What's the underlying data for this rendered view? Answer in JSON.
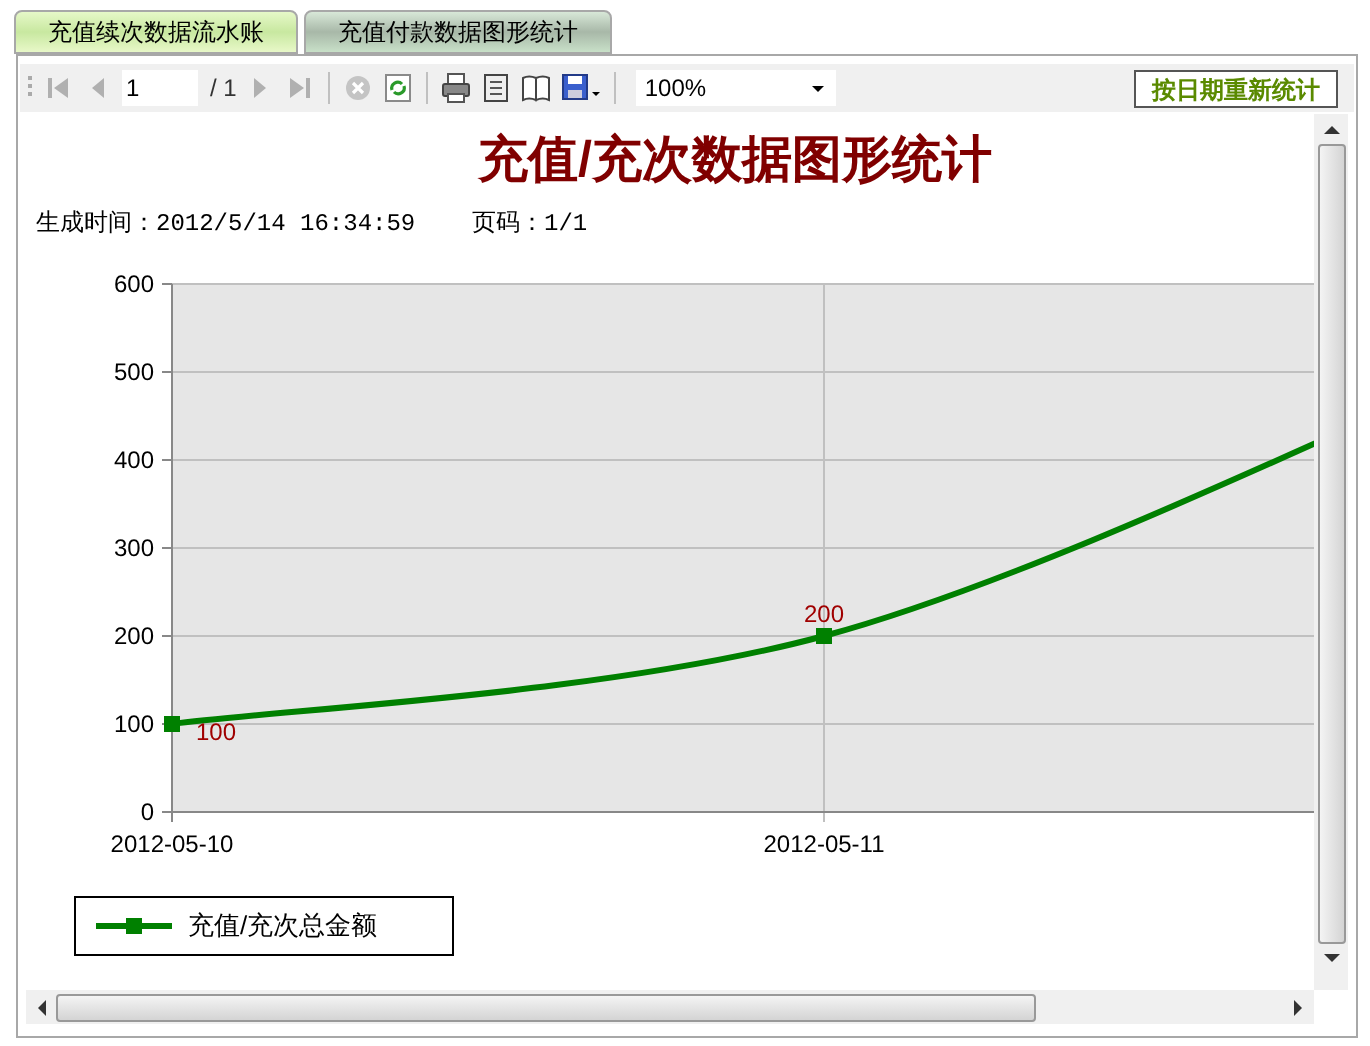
{
  "tabs": [
    {
      "label": "充值续次数据流水账",
      "selected": false
    },
    {
      "label": "充值付款数据图形统计",
      "selected": true
    }
  ],
  "toolbar": {
    "page": "1",
    "page_count": "/ 1",
    "zoom": "100%"
  },
  "regenerate_button": "按日期重新统计",
  "report": {
    "title": "充值/充次数据图形统计",
    "generated": "生成时间：2012/5/14 16:34:59",
    "page_info": "页码：1/1"
  },
  "chart_data": {
    "type": "line",
    "categories": [
      "2012-05-10",
      "2012-05-11"
    ],
    "yticks": [
      0,
      100,
      200,
      300,
      400,
      500,
      600
    ],
    "ylim": [
      0,
      600
    ],
    "data_labels": true,
    "grid": true,
    "series": [
      {
        "name": "充值/充次总金额",
        "color": "#008000",
        "marker": "square",
        "values": [
          100,
          200
        ]
      }
    ]
  }
}
